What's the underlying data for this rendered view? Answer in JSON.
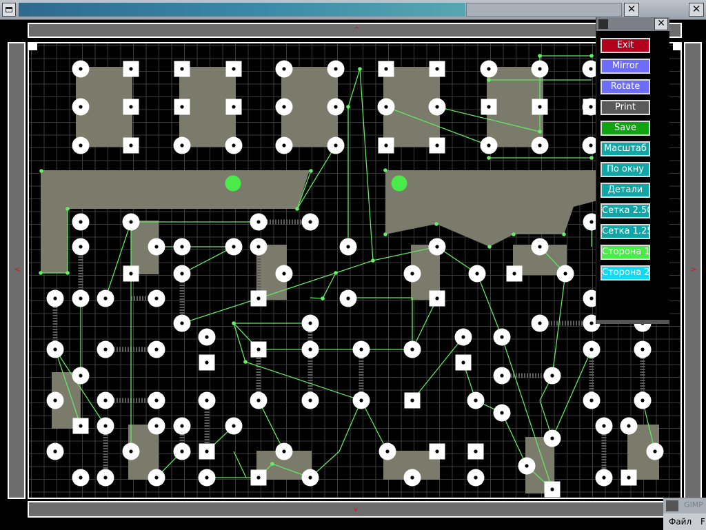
{
  "window": {
    "title": ""
  },
  "taskbar": {
    "task1": "",
    "task2": "GIMP"
  },
  "tray_menu": {
    "file": "Файл",
    "more": "F"
  },
  "scroll_arrows": {
    "up": "^",
    "down": "v",
    "left": "<",
    "right": ">"
  },
  "panel": {
    "buttons": [
      {
        "label": "Exit",
        "color": "#b3001c"
      },
      {
        "label": "Mirror",
        "color": "#6d6dfd"
      },
      {
        "label": "Rotate",
        "color": "#6d6dfd"
      },
      {
        "label": "Print",
        "color": "#5a5a5a"
      },
      {
        "label": "Save",
        "color": "#11a311"
      },
      {
        "label": "Масштаб",
        "color": "#11a5a5"
      },
      {
        "label": "По окну",
        "color": "#11a5a5"
      },
      {
        "label": "Детали",
        "color": "#11a5a5"
      },
      {
        "label": "Сетка 2.50",
        "color": "#11a5a5"
      },
      {
        "label": "Сетка 1.25",
        "color": "#11a5a5"
      },
      {
        "label": "Сторона 1",
        "color": "#44ee44"
      },
      {
        "label": "Сторона 2",
        "color": "#11d9f1"
      }
    ]
  },
  "colors": {
    "board": "#000000",
    "grid": "#3b3b3b",
    "component": "#7b7b6b",
    "trace": "#62e862",
    "pad": "#ffffff",
    "via": "#66ee66"
  }
}
